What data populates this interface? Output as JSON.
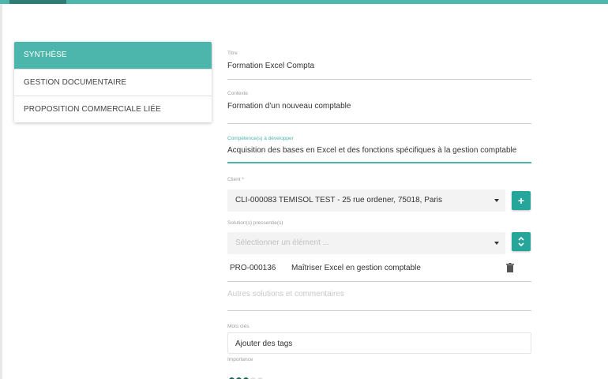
{
  "colors": {
    "accent": "#4db6ac",
    "accent_dark": "#26a69a",
    "importance_on": "#1f6058"
  },
  "sidebar": {
    "items": [
      {
        "label": "SYNTHÈSE",
        "active": true
      },
      {
        "label": "GESTION DOCUMENTAIRE",
        "active": false
      },
      {
        "label": "PROPOSITION COMMERCIALE LIÉE",
        "active": false
      }
    ]
  },
  "form": {
    "titre": {
      "label": "Titre",
      "value": "Formation Excel Compta"
    },
    "contexte": {
      "label": "Contexte",
      "value": "Formation d'un nouveau comptable"
    },
    "competences": {
      "label": "Compétence(s) à développer",
      "value": "Acquisition des bases en Excel et des fonctions spécifiques à la gestion comptable"
    },
    "client": {
      "label": "Client *",
      "value": "CLI-000083 TEMISOL TEST - 25 rue ordener, 75018, Paris",
      "add_icon": "plus-icon"
    },
    "solutions": {
      "label": "Solution(s) pressentie(s)",
      "placeholder": "Sélectionner un élément ...",
      "toggle_icon": "unfold-icon",
      "selected": [
        {
          "code": "PRO-000136",
          "label": "Maîtriser Excel en gestion comptable",
          "delete_icon": "trash-icon"
        }
      ]
    },
    "autres": {
      "placeholder": "Autres solutions et commentaires"
    },
    "mots_cles": {
      "label": "Mots clés",
      "placeholder": "Ajouter des tags"
    },
    "importance": {
      "label": "Importance",
      "value": 3,
      "max": 5
    }
  }
}
